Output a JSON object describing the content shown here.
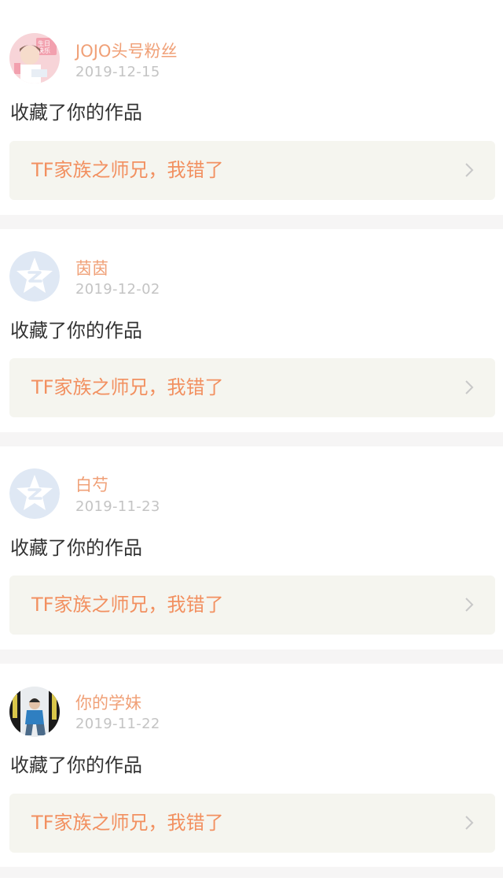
{
  "colors": {
    "accent_pink": "#ec6b9a",
    "username_orange": "#f0a077",
    "link_orange": "#f29060",
    "date_gray": "#c4c4c4",
    "card_bg": "#f5f5ef",
    "separator": "#f6f5f5"
  },
  "feed": [
    {
      "avatar_icon": "photo-avatar",
      "username": "JOJO头号粉丝",
      "date": "2019-12-15",
      "action": "收藏了你的作品",
      "work_title": "TF家族之师兄，我错了",
      "chevron_icon": "chevron-right-icon"
    },
    {
      "avatar_icon": "default-star-avatar",
      "username": "茵茵",
      "date": "2019-12-02",
      "action": "收藏了你的作品",
      "work_title": "TF家族之师兄，我错了",
      "chevron_icon": "chevron-right-icon"
    },
    {
      "avatar_icon": "default-star-avatar",
      "username": "白芍",
      "date": "2019-11-23",
      "action": "收藏了你的作品",
      "work_title": "TF家族之师兄，我错了",
      "chevron_icon": "chevron-right-icon"
    },
    {
      "avatar_icon": "photo-avatar",
      "username": "你的学妹",
      "date": "2019-11-22",
      "action": "收藏了你的作品",
      "work_title": "TF家族之师兄，我错了",
      "chevron_icon": "chevron-right-icon"
    }
  ]
}
